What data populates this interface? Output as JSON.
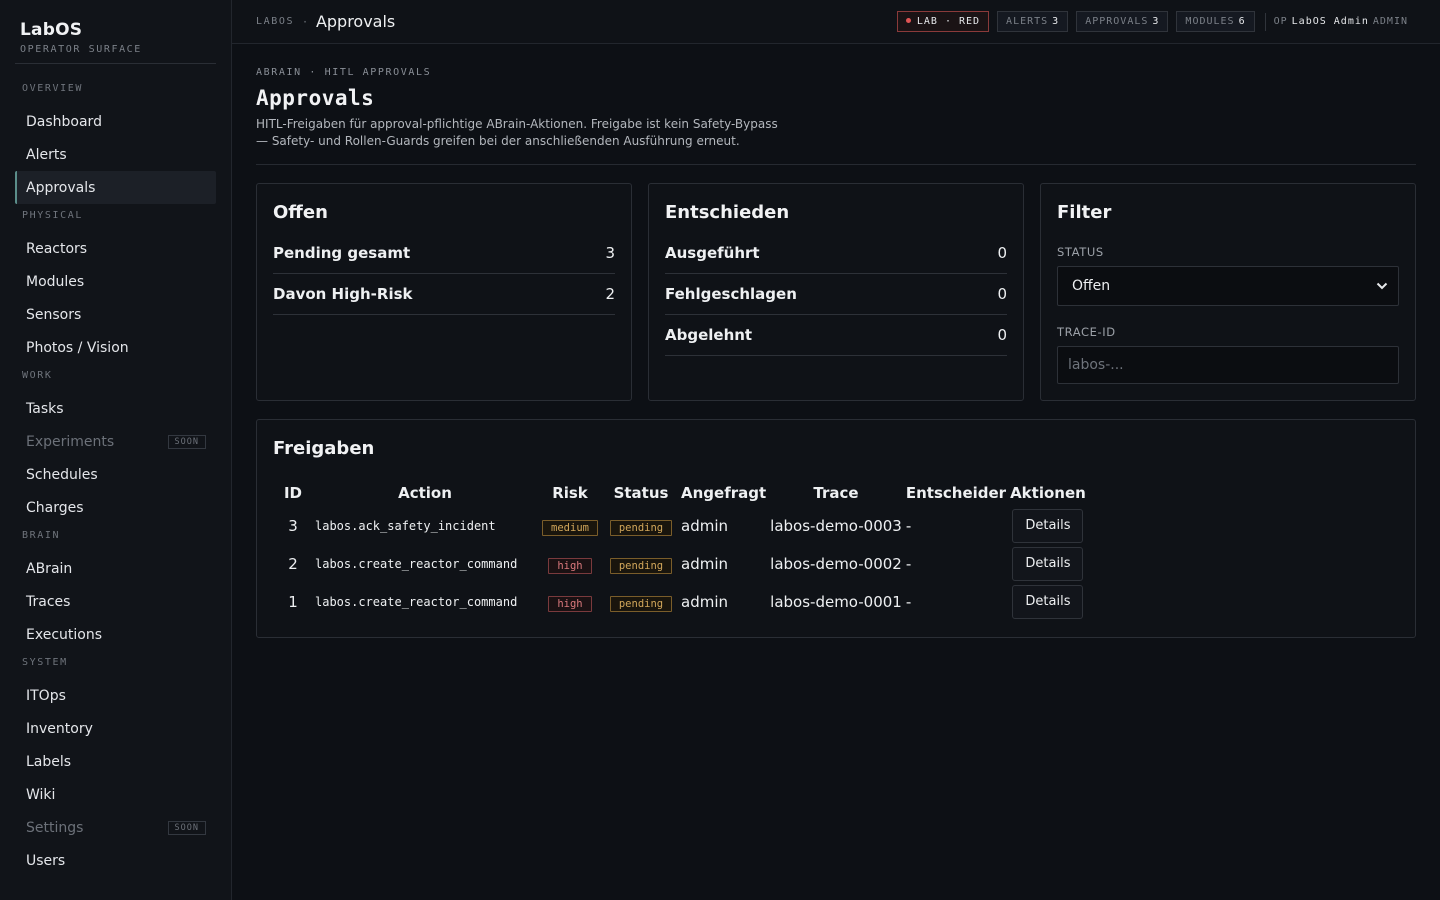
{
  "brand": {
    "name": "LabOS",
    "subtitle": "OPERATOR SURFACE"
  },
  "sidebar": {
    "sections": [
      {
        "title": "OVERVIEW",
        "items": [
          {
            "label": "Dashboard"
          },
          {
            "label": "Alerts"
          },
          {
            "label": "Approvals",
            "active": true
          }
        ]
      },
      {
        "title": "PHYSICAL",
        "items": [
          {
            "label": "Reactors"
          },
          {
            "label": "Modules"
          },
          {
            "label": "Sensors"
          },
          {
            "label": "Photos / Vision"
          }
        ]
      },
      {
        "title": "WORK",
        "items": [
          {
            "label": "Tasks"
          },
          {
            "label": "Experiments",
            "badge": "SOON"
          },
          {
            "label": "Schedules"
          },
          {
            "label": "Charges"
          }
        ]
      },
      {
        "title": "BRAIN",
        "items": [
          {
            "label": "ABrain"
          },
          {
            "label": "Traces"
          },
          {
            "label": "Executions"
          }
        ]
      },
      {
        "title": "SYSTEM",
        "items": [
          {
            "label": "ITOps"
          },
          {
            "label": "Inventory"
          },
          {
            "label": "Labels"
          },
          {
            "label": "Wiki"
          },
          {
            "label": "Settings",
            "badge": "SOON"
          },
          {
            "label": "Users"
          }
        ]
      }
    ]
  },
  "topbar": {
    "crumb_root": "LABOS",
    "crumb_sep": "·",
    "crumb_current": "Approvals",
    "lab_status": "LAB · RED",
    "alerts_label": "ALERTS",
    "alerts_count": "3",
    "approvals_label": "APPROVALS",
    "approvals_count": "3",
    "modules_label": "MODULES",
    "modules_count": "6",
    "op_label": "OP",
    "op_user": "LabOS Admin",
    "op_role": "ADMIN"
  },
  "page": {
    "eyebrow": "ABRAIN · HITL APPROVALS",
    "title": "Approvals",
    "description_line1": "HITL-Freigaben für approval-pflichtige ABrain-Aktionen. Freigabe ist kein Safety-Bypass",
    "description_line2": "— Safety- und Rollen-Guards greifen bei der anschließenden Ausführung erneut."
  },
  "offen": {
    "title": "Offen",
    "rows": [
      {
        "label": "Pending gesamt",
        "value": "3"
      },
      {
        "label": "Davon High-Risk",
        "value": "2"
      }
    ]
  },
  "entschieden": {
    "title": "Entschieden",
    "rows": [
      {
        "label": "Ausgeführt",
        "value": "0"
      },
      {
        "label": "Fehlgeschlagen",
        "value": "0"
      },
      {
        "label": "Abgelehnt",
        "value": "0"
      }
    ]
  },
  "filter": {
    "title": "Filter",
    "status_label": "STATUS",
    "status_value": "Offen",
    "trace_label": "TRACE-ID",
    "trace_placeholder": "labos-..."
  },
  "freigaben": {
    "title": "Freigaben",
    "columns": [
      "ID",
      "Action",
      "Risk",
      "Status",
      "Angefragt",
      "Trace",
      "Entscheider",
      "Aktionen"
    ],
    "rows": [
      {
        "id": "3",
        "action": "labos.ack_safety_incident",
        "risk": "medium",
        "status": "pending",
        "requested_by": "admin",
        "trace": "labos-demo-0003",
        "decider": "-",
        "action_button": "Details"
      },
      {
        "id": "2",
        "action": "labos.create_reactor_command",
        "risk": "high",
        "status": "pending",
        "requested_by": "admin",
        "trace": "labos-demo-0002",
        "decider": "-",
        "action_button": "Details"
      },
      {
        "id": "1",
        "action": "labos.create_reactor_command",
        "risk": "high",
        "status": "pending",
        "requested_by": "admin",
        "trace": "labos-demo-0001",
        "decider": "-",
        "action_button": "Details"
      }
    ]
  }
}
